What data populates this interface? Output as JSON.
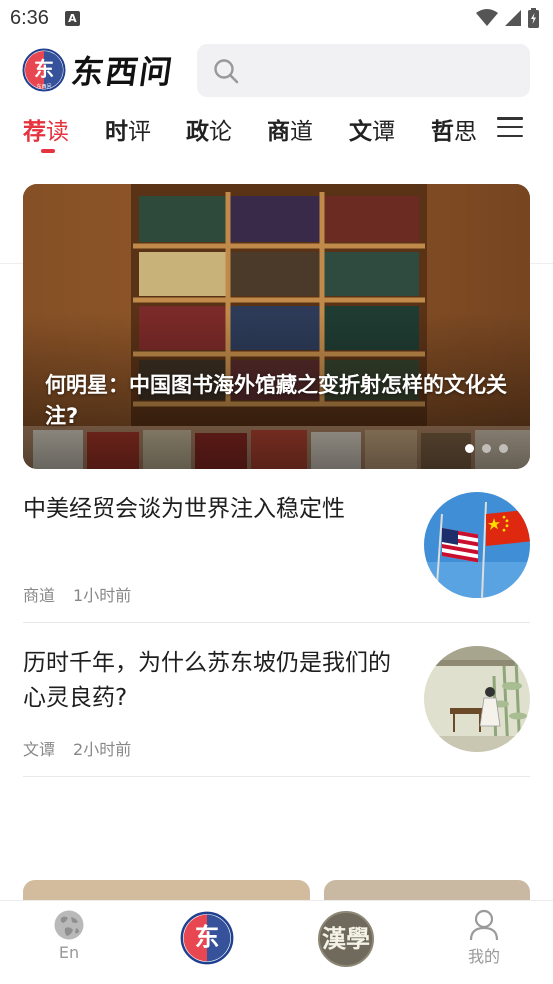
{
  "status_bar": {
    "time": "6:36",
    "notification_icon": "A"
  },
  "header": {
    "logo_text": "东西问",
    "logo_small_text": "东西问",
    "search": {
      "placeholder": ""
    }
  },
  "tabs": [
    {
      "first": "荐",
      "rest": "读",
      "active": true
    },
    {
      "first": "时",
      "rest": "评"
    },
    {
      "first": "政",
      "rest": "论"
    },
    {
      "first": "商",
      "rest": "道"
    },
    {
      "first": "文",
      "rest": "谭"
    },
    {
      "first": "哲",
      "rest": "思"
    }
  ],
  "banner": {
    "title": "何明星：中国图书海外馆藏之变折射怎样的文化关注?",
    "dots": 3,
    "active_dot": 0
  },
  "news": [
    {
      "title": "中美经贸会谈为世界注入稳定性",
      "category": "商道",
      "time": "1小时前",
      "thumb": "us-china-flags"
    },
    {
      "title": "历时千年，为什么苏东坡仍是我们的心灵良药?",
      "category": "文谭",
      "time": "2小时前",
      "thumb": "scholar-painting"
    }
  ],
  "bottom_nav": [
    {
      "label": "En",
      "icon": "globe-icon"
    },
    {
      "label": "",
      "icon": "dongxiwen-logo-icon"
    },
    {
      "label": "",
      "icon": "hanxue-seal-icon"
    },
    {
      "label": "我的",
      "icon": "user-icon"
    }
  ],
  "colors": {
    "accent": "#e5333f",
    "text": "#1e1e1e",
    "meta": "#888888",
    "search_bg": "#f1f1f3"
  }
}
